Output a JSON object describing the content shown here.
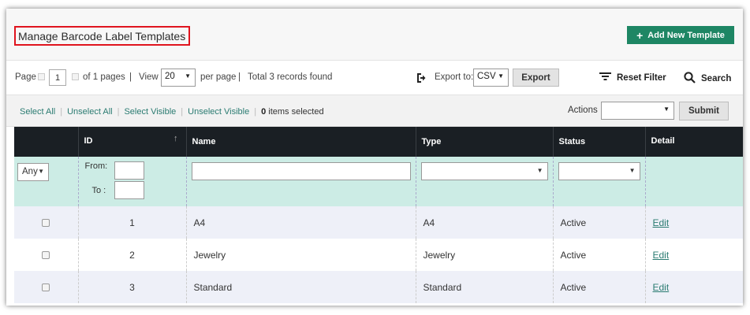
{
  "header": {
    "title": "Manage Barcode Label Templates",
    "add_button": "Add New Template",
    "add_icon": "+"
  },
  "pager": {
    "page_label": "Page",
    "page_value": "1",
    "of_pages": "of 1 pages",
    "sep1": "|",
    "view_label": "View",
    "per_page_value": "20",
    "per_page_label": "per page",
    "sep2": "|",
    "total": "Total 3 records found",
    "export_to_label": "Export to:",
    "export_format": "CSV",
    "export_button": "Export",
    "reset_filter": "Reset Filter",
    "search": "Search"
  },
  "massaction": {
    "select_all": "Select All",
    "unselect_all": "Unselect All",
    "select_visible": "Select Visible",
    "unselect_visible": "Unselect Visible",
    "sep": "|",
    "selected_count": "0",
    "selected_suffix": " items selected",
    "actions_label": "Actions",
    "actions_value": "",
    "submit": "Submit"
  },
  "grid": {
    "columns": [
      "ID",
      "Name",
      "Type",
      "Status",
      "Detail"
    ],
    "filter": {
      "any": "Any",
      "from": "From:",
      "to": "To :"
    },
    "rows": [
      {
        "id": "1",
        "name": "A4",
        "type": "A4",
        "status": "Active",
        "detail": "Edit"
      },
      {
        "id": "2",
        "name": "Jewelry",
        "type": "Jewelry",
        "status": "Active",
        "detail": "Edit"
      },
      {
        "id": "3",
        "name": "Standard",
        "type": "Standard",
        "status": "Active",
        "detail": "Edit"
      }
    ]
  },
  "colors": {
    "accent": "#1e8664",
    "header_dark": "#1a1f24",
    "filter_bg": "#ccece5",
    "link": "#2a7b71",
    "title_outline": "#e0141e"
  }
}
